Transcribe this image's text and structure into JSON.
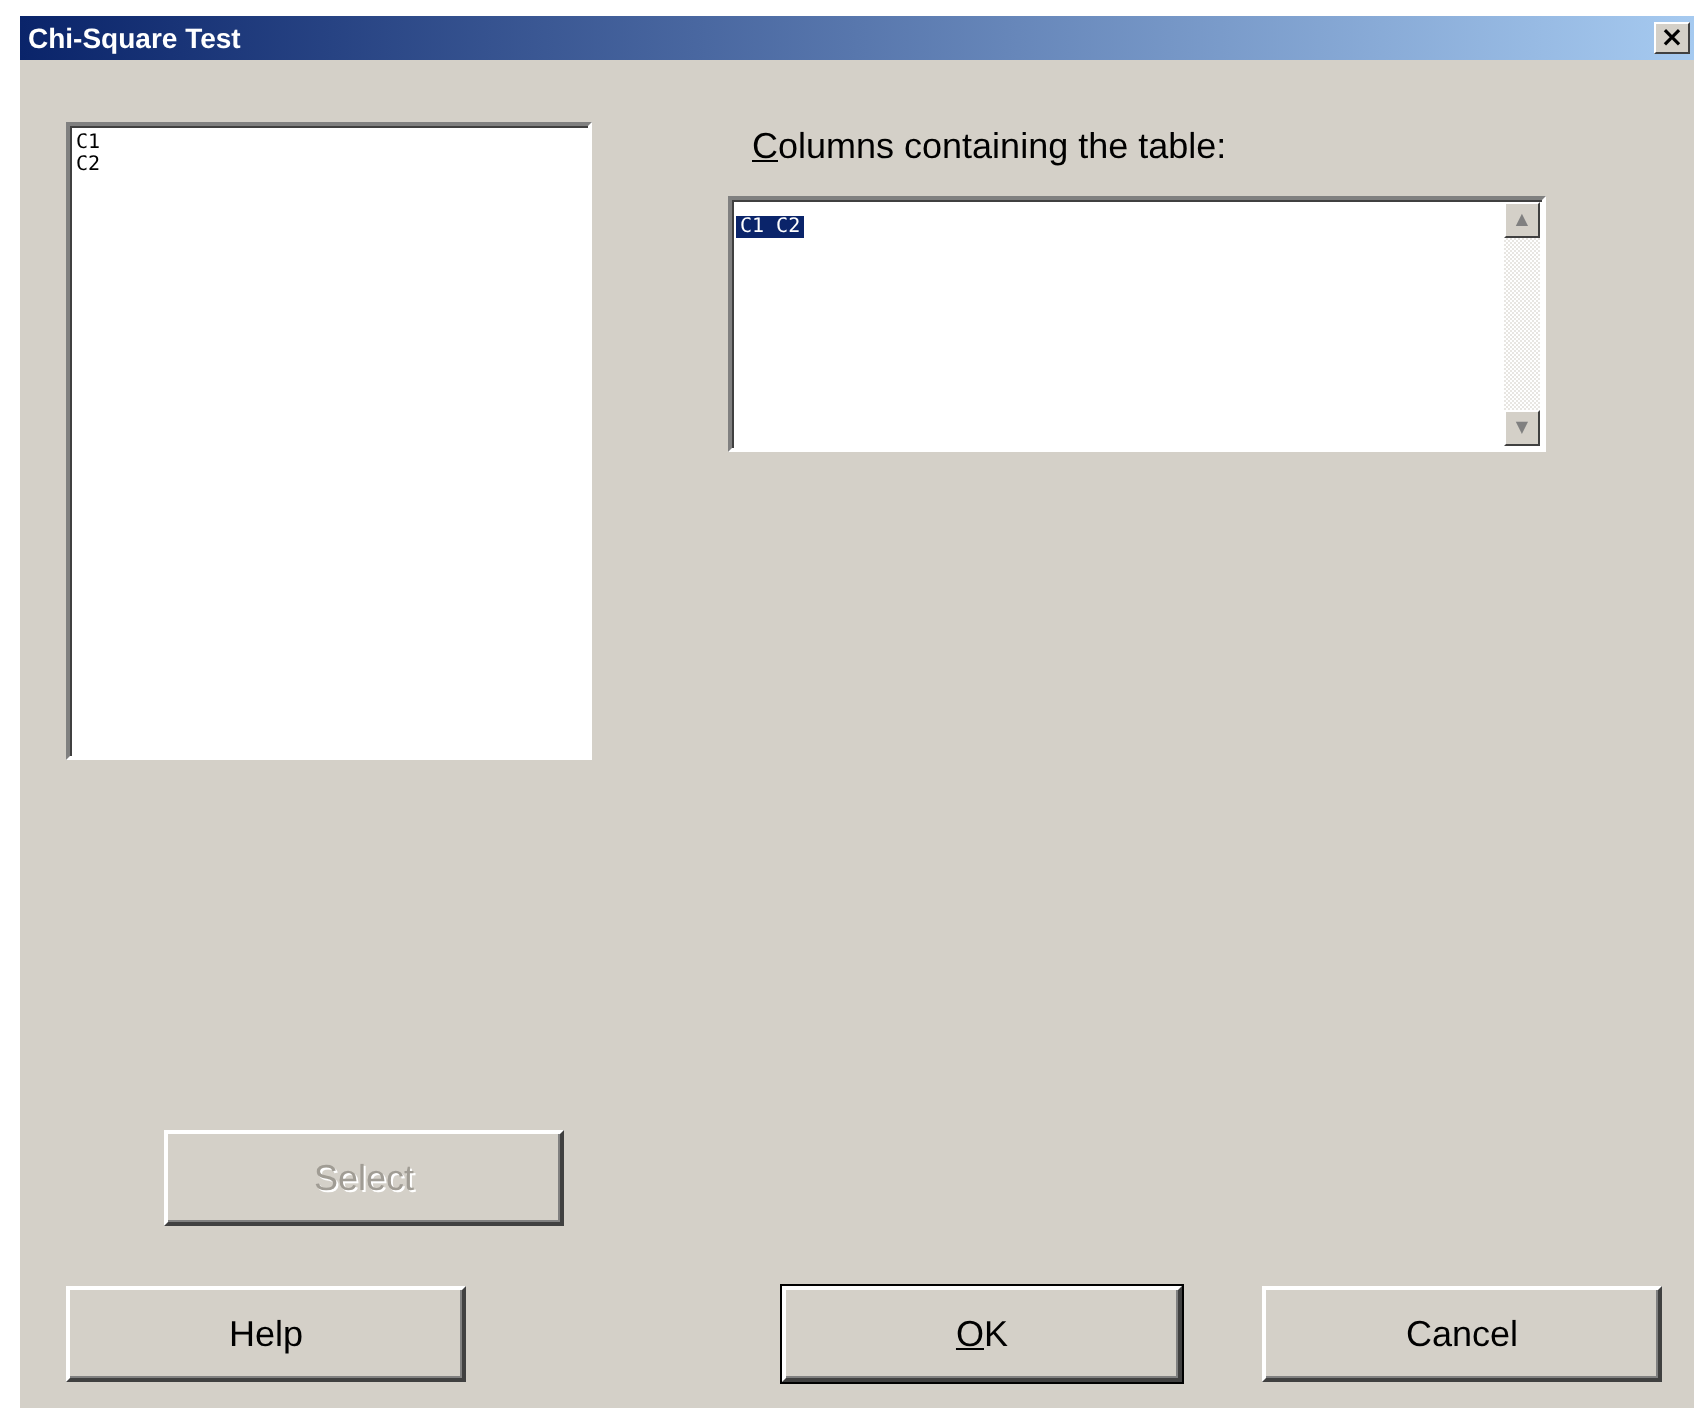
{
  "window": {
    "title": "Chi-Square Test",
    "close_label": "×"
  },
  "variables_list": {
    "items": [
      {
        "label": "C1",
        "selected": false
      },
      {
        "label": "C2",
        "selected": false
      }
    ]
  },
  "columns_field": {
    "label": "Columns containing the table:",
    "label_access_key_underlined": true,
    "value": "C1 C2",
    "value_selected": true,
    "scrollbar": {
      "up": "▲",
      "down": "▼"
    }
  },
  "select_button": {
    "label": "Select",
    "disabled": true
  },
  "buttons": [
    {
      "kind": "help",
      "label": "Help",
      "default": false,
      "access_key_underlined": false
    },
    {
      "kind": "ok",
      "label": "OK",
      "default": true,
      "access_key_underlined": true
    },
    {
      "kind": "cancel",
      "label": "Cancel",
      "default": false,
      "access_key_underlined": false
    }
  ]
}
